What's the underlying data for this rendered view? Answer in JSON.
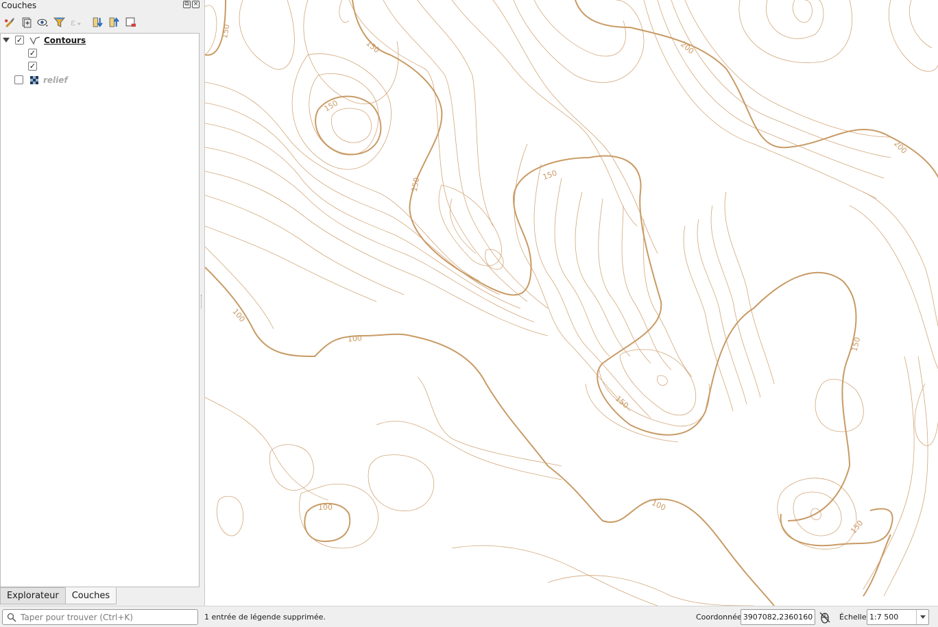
{
  "panel": {
    "title": "Couches",
    "float_btn": "⧉",
    "close_btn": "×"
  },
  "toolbar": {
    "icons": [
      "style-manager-icon",
      "add-group-icon",
      "visibility-icon",
      "filter-icon",
      "expression-filter-icon",
      "expand-all-icon",
      "collapse-all-icon",
      "remove-layer-icon"
    ]
  },
  "layers": [
    {
      "name": "Contours",
      "checked": true,
      "expanded": true,
      "type": "vector-line",
      "children": [
        {
          "label": "",
          "checked": true
        },
        {
          "label": "",
          "checked": true
        }
      ]
    },
    {
      "name": "relief",
      "checked": false,
      "type": "raster"
    }
  ],
  "tabs": [
    {
      "label": "Explorateur",
      "active": false
    },
    {
      "label": "Couches",
      "active": true
    }
  ],
  "search": {
    "placeholder": "Taper pour trouver (Ctrl+K)"
  },
  "status": {
    "message": "1 entrée de légende supprimée.",
    "coord_label": "Coordonnée",
    "coord_value": "3907082,2360160",
    "scale_label": "Échelle",
    "scale_value": "1:7 500"
  },
  "map": {
    "contour_color": "#d2a679",
    "labels": [
      "150",
      "150",
      "150",
      "200",
      "200",
      "150",
      "150",
      "100",
      "100",
      "150",
      "150",
      "100",
      "100",
      "150"
    ]
  }
}
